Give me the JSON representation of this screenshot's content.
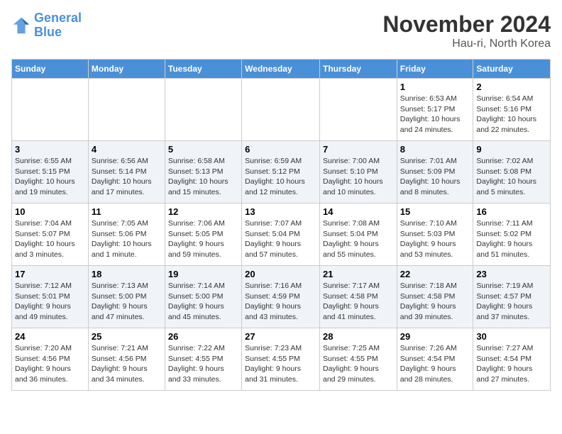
{
  "logo": {
    "line1": "General",
    "line2": "Blue"
  },
  "title": "November 2024",
  "subtitle": "Hau-ri, North Korea",
  "weekdays": [
    "Sunday",
    "Monday",
    "Tuesday",
    "Wednesday",
    "Thursday",
    "Friday",
    "Saturday"
  ],
  "weeks": [
    [
      {
        "day": "",
        "info": ""
      },
      {
        "day": "",
        "info": ""
      },
      {
        "day": "",
        "info": ""
      },
      {
        "day": "",
        "info": ""
      },
      {
        "day": "",
        "info": ""
      },
      {
        "day": "1",
        "info": "Sunrise: 6:53 AM\nSunset: 5:17 PM\nDaylight: 10 hours\nand 24 minutes."
      },
      {
        "day": "2",
        "info": "Sunrise: 6:54 AM\nSunset: 5:16 PM\nDaylight: 10 hours\nand 22 minutes."
      }
    ],
    [
      {
        "day": "3",
        "info": "Sunrise: 6:55 AM\nSunset: 5:15 PM\nDaylight: 10 hours\nand 19 minutes."
      },
      {
        "day": "4",
        "info": "Sunrise: 6:56 AM\nSunset: 5:14 PM\nDaylight: 10 hours\nand 17 minutes."
      },
      {
        "day": "5",
        "info": "Sunrise: 6:58 AM\nSunset: 5:13 PM\nDaylight: 10 hours\nand 15 minutes."
      },
      {
        "day": "6",
        "info": "Sunrise: 6:59 AM\nSunset: 5:12 PM\nDaylight: 10 hours\nand 12 minutes."
      },
      {
        "day": "7",
        "info": "Sunrise: 7:00 AM\nSunset: 5:10 PM\nDaylight: 10 hours\nand 10 minutes."
      },
      {
        "day": "8",
        "info": "Sunrise: 7:01 AM\nSunset: 5:09 PM\nDaylight: 10 hours\nand 8 minutes."
      },
      {
        "day": "9",
        "info": "Sunrise: 7:02 AM\nSunset: 5:08 PM\nDaylight: 10 hours\nand 5 minutes."
      }
    ],
    [
      {
        "day": "10",
        "info": "Sunrise: 7:04 AM\nSunset: 5:07 PM\nDaylight: 10 hours\nand 3 minutes."
      },
      {
        "day": "11",
        "info": "Sunrise: 7:05 AM\nSunset: 5:06 PM\nDaylight: 10 hours\nand 1 minute."
      },
      {
        "day": "12",
        "info": "Sunrise: 7:06 AM\nSunset: 5:05 PM\nDaylight: 9 hours\nand 59 minutes."
      },
      {
        "day": "13",
        "info": "Sunrise: 7:07 AM\nSunset: 5:04 PM\nDaylight: 9 hours\nand 57 minutes."
      },
      {
        "day": "14",
        "info": "Sunrise: 7:08 AM\nSunset: 5:04 PM\nDaylight: 9 hours\nand 55 minutes."
      },
      {
        "day": "15",
        "info": "Sunrise: 7:10 AM\nSunset: 5:03 PM\nDaylight: 9 hours\nand 53 minutes."
      },
      {
        "day": "16",
        "info": "Sunrise: 7:11 AM\nSunset: 5:02 PM\nDaylight: 9 hours\nand 51 minutes."
      }
    ],
    [
      {
        "day": "17",
        "info": "Sunrise: 7:12 AM\nSunset: 5:01 PM\nDaylight: 9 hours\nand 49 minutes."
      },
      {
        "day": "18",
        "info": "Sunrise: 7:13 AM\nSunset: 5:00 PM\nDaylight: 9 hours\nand 47 minutes."
      },
      {
        "day": "19",
        "info": "Sunrise: 7:14 AM\nSunset: 5:00 PM\nDaylight: 9 hours\nand 45 minutes."
      },
      {
        "day": "20",
        "info": "Sunrise: 7:16 AM\nSunset: 4:59 PM\nDaylight: 9 hours\nand 43 minutes."
      },
      {
        "day": "21",
        "info": "Sunrise: 7:17 AM\nSunset: 4:58 PM\nDaylight: 9 hours\nand 41 minutes."
      },
      {
        "day": "22",
        "info": "Sunrise: 7:18 AM\nSunset: 4:58 PM\nDaylight: 9 hours\nand 39 minutes."
      },
      {
        "day": "23",
        "info": "Sunrise: 7:19 AM\nSunset: 4:57 PM\nDaylight: 9 hours\nand 37 minutes."
      }
    ],
    [
      {
        "day": "24",
        "info": "Sunrise: 7:20 AM\nSunset: 4:56 PM\nDaylight: 9 hours\nand 36 minutes."
      },
      {
        "day": "25",
        "info": "Sunrise: 7:21 AM\nSunset: 4:56 PM\nDaylight: 9 hours\nand 34 minutes."
      },
      {
        "day": "26",
        "info": "Sunrise: 7:22 AM\nSunset: 4:55 PM\nDaylight: 9 hours\nand 33 minutes."
      },
      {
        "day": "27",
        "info": "Sunrise: 7:23 AM\nSunset: 4:55 PM\nDaylight: 9 hours\nand 31 minutes."
      },
      {
        "day": "28",
        "info": "Sunrise: 7:25 AM\nSunset: 4:55 PM\nDaylight: 9 hours\nand 29 minutes."
      },
      {
        "day": "29",
        "info": "Sunrise: 7:26 AM\nSunset: 4:54 PM\nDaylight: 9 hours\nand 28 minutes."
      },
      {
        "day": "30",
        "info": "Sunrise: 7:27 AM\nSunset: 4:54 PM\nDaylight: 9 hours\nand 27 minutes."
      }
    ]
  ]
}
